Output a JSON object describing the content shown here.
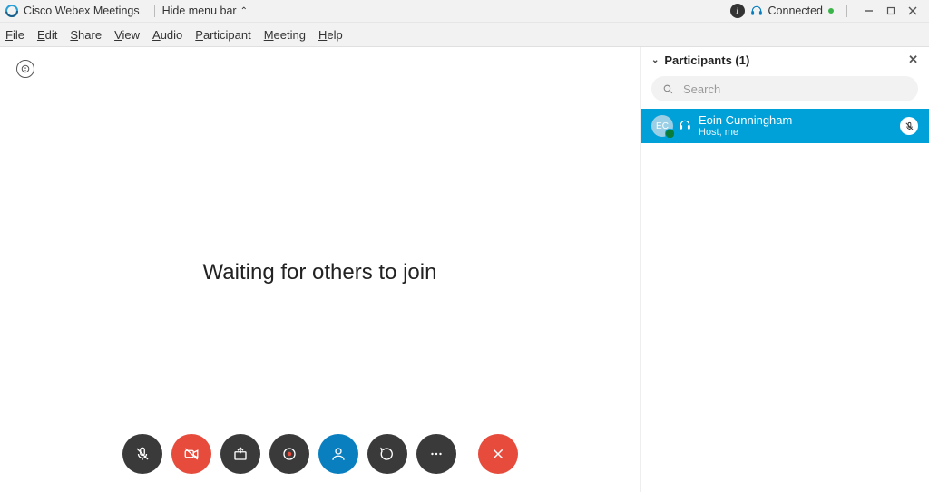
{
  "title_bar": {
    "app_title": "Cisco Webex Meetings",
    "hide_menu_label": "Hide menu bar",
    "connection_label": "Connected"
  },
  "menu": {
    "file": "File",
    "edit": "Edit",
    "share": "Share",
    "view": "View",
    "audio": "Audio",
    "participant": "Participant",
    "meeting": "Meeting",
    "help": "Help"
  },
  "video": {
    "waiting_label": "Waiting for others to join"
  },
  "controls": {
    "mute": "mute",
    "video": "stop-video",
    "share": "share",
    "record": "record",
    "participants": "participants",
    "chat": "chat",
    "more": "more-options",
    "end": "end-meeting"
  },
  "participants_panel": {
    "title": "Participants (1)",
    "search_placeholder": "Search",
    "items": [
      {
        "initials": "EC",
        "name": "Eoin  Cunningham",
        "subtitle": "Host, me",
        "muted": true
      }
    ]
  }
}
